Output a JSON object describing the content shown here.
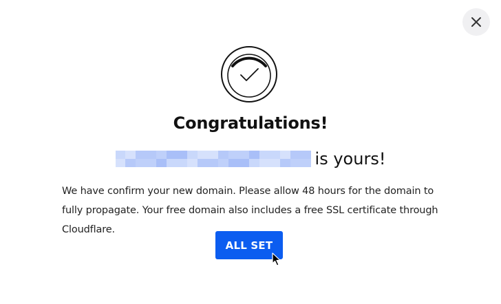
{
  "dialog": {
    "close_icon": "close-icon",
    "badge_icon": "check-circle-icon",
    "title": "Congratulations!",
    "domain_suffix": "is yours!",
    "message": "We have confirm your new domain. Please allow 48 hours for the domain to fully propagate. Your free domain also includes a free SSL certificate through Cloudflare.",
    "primary_button_label": "ALL SET"
  },
  "colors": {
    "primary": "#0c5df0",
    "close_bg": "#f0f0f2",
    "text": "#111111",
    "pixelated_domain": [
      "#c9d8fb",
      "#b6c9f9",
      "#a9bff8",
      "#d6e1fc",
      "#bfd0fa"
    ]
  },
  "cursor": {
    "icon": "mouse-pointer-icon"
  }
}
